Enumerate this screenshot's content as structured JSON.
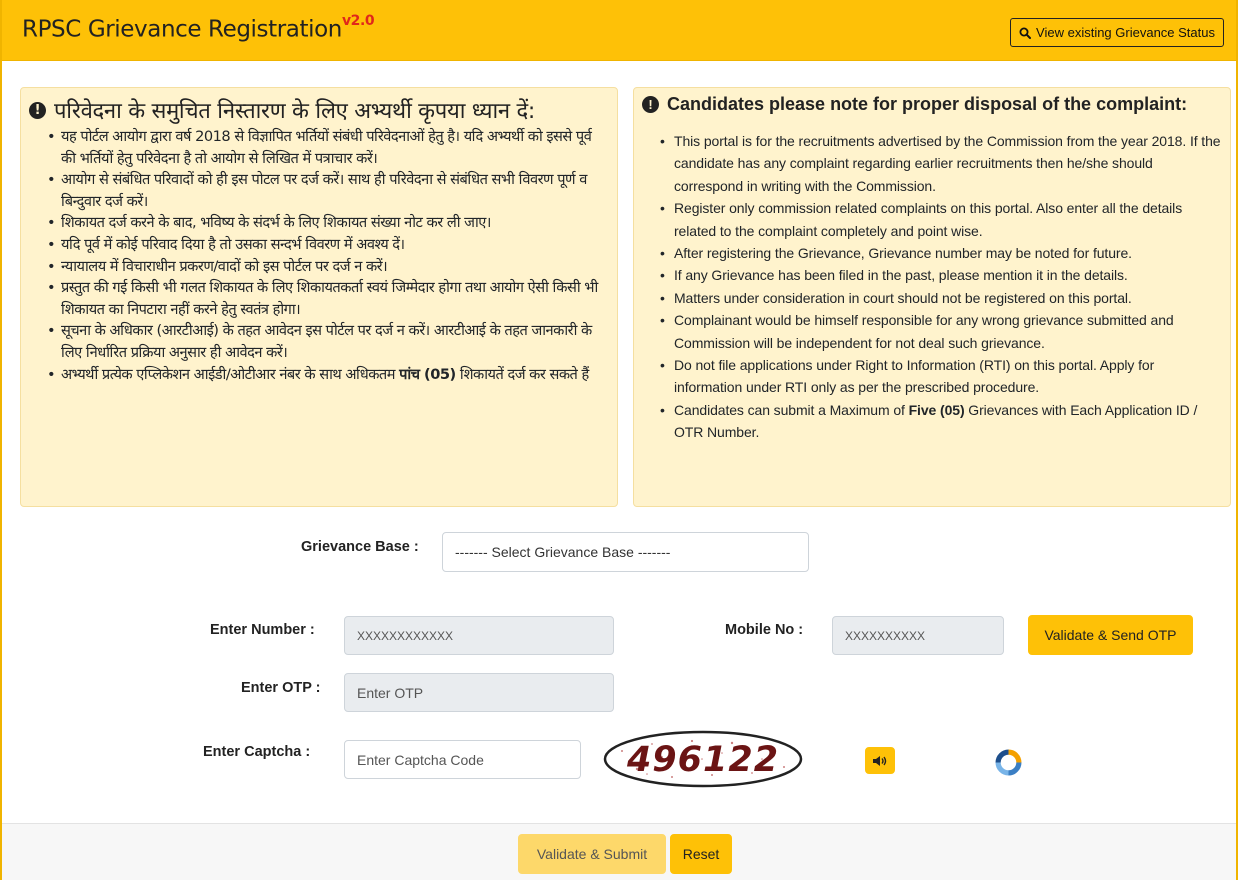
{
  "header": {
    "title": "RPSC Grievance Registration",
    "version": "v2.0",
    "status_button": "View existing Grievance Status",
    "status_icon": "search-icon"
  },
  "notes": {
    "hindi": {
      "heading": "परिवेदना के समुचित निस्तारण के लिए अभ्यर्थी कृपया ध्यान दें:",
      "items": [
        "यह पोर्टल आयोग द्वारा वर्ष 2018 से विज्ञापित भर्तियों संबंधी परिवेदनाओं हेतु है। यदि अभ्यर्थी को इससे पूर्व की भर्तियों हेतु परिवेदना है तो आयोग से लिखित में पत्राचार करें।",
        "आयोग से संबंधित परिवादों को ही इस पोटल पर दर्ज करें। साथ ही परिवेदना से संबंधित सभी विवरण पूर्ण व बिन्दुवार दर्ज करें।",
        "शिकायत दर्ज करने के बाद, भविष्य के संदर्भ के लिए शिकायत संख्या नोट कर ली जाए।",
        "यदि पूर्व में कोई परिवाद दिया है तो उसका सन्दर्भ विवरण में अवश्य दें।",
        "न्यायालय में विचाराधीन प्रकरण/वादों को इस पोर्टल पर दर्ज न करें।",
        "प्रस्तुत की गई किसी भी गलत शिकायत के लिए शिकायतकर्ता स्वयं जिम्मेदार होगा तथा आयोग ऐसी किसी भी शिकायत का निपटारा नहीं करने हेतु स्वतंत्र होगा।",
        "सूचना के अधिकार (आरटीआई) के तहत आवेदन इस पोर्टल पर दर्ज न करें। आरटीआई के तहत जानकारी के लिए निर्धारित प्रक्रिया अनुसार ही आवेदन करें।"
      ],
      "last_item_before": "अभ्यर्थी प्रत्येक एप्लिकेशन आईडी/ओटीआर नंबर के साथ अधिकतम ",
      "last_item_bold": "पांच (05)",
      "last_item_after": " शिकायतें दर्ज कर सकते हैं"
    },
    "english": {
      "heading": "Candidates please note for proper disposal of the complaint:",
      "items": [
        "This portal is for the recruitments advertised by the Commission from the year 2018. If the candidate has any complaint regarding earlier recruitments then he/she should correspond in writing with the Commission.",
        "Register only commission related complaints on this portal. Also enter all the details related to the complaint completely and point wise.",
        "After registering the Grievance, Grievance number may be noted for future.",
        "If any Grievance has been filed in the past, please mention it in the details.",
        "Matters under consideration in court should not be registered on this portal.",
        "Complainant would be himself responsible for any wrong grievance submitted and Commission will be independent for not deal such grievance.",
        "Do not file applications under Right to Information (RTI) on this portal. Apply for information under RTI only as per the prescribed procedure."
      ],
      "last_item_before": "Candidates can submit a Maximum of ",
      "last_item_bold": "Five (05)",
      "last_item_after": " Grievances with Each Application ID / OTR Number."
    }
  },
  "form": {
    "grievance_base_label": "Grievance Base :",
    "grievance_base_value": "------- Select Grievance Base -------",
    "number_label": "Enter Number :",
    "number_value": "XXXXXXXXXXXX",
    "mobile_label": "Mobile No :",
    "mobile_value": "XXXXXXXXXX",
    "send_otp_label": "Validate & Send OTP",
    "otp_label": "Enter OTP :",
    "otp_placeholder": "Enter OTP",
    "captcha_label": "Enter Captcha   :",
    "captcha_placeholder": "Enter Captcha Code",
    "captcha_text": "496122",
    "audio_icon": "speaker-icon",
    "refresh_icon": "refresh-icon"
  },
  "footer": {
    "submit_label": "Validate & Submit",
    "reset_label": "Reset"
  },
  "colors": {
    "accent": "#fec107",
    "note_bg": "#fff3cd",
    "version_red": "#e0271b"
  }
}
